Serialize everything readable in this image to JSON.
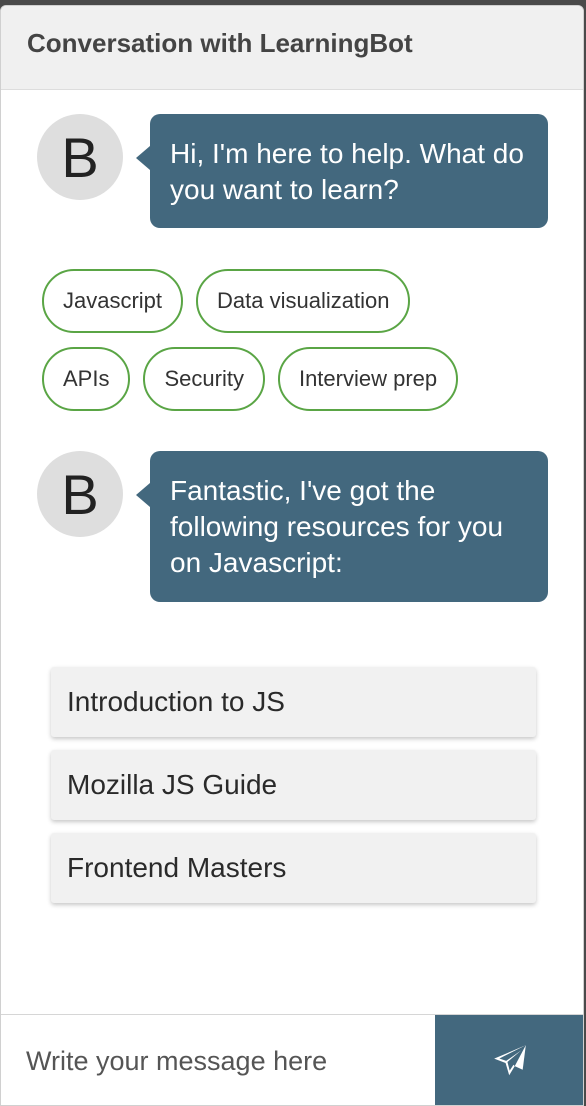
{
  "header": {
    "title": "Conversation with LearningBot"
  },
  "messages": [
    {
      "avatar_letter": "B",
      "text": "Hi, I'm here to help. What do you want to learn?"
    },
    {
      "avatar_letter": "B",
      "text": "Fantastic, I've got the following resources for you on Javascript:"
    }
  ],
  "topics": [
    "Javascript",
    "Data visualization",
    "APIs",
    "Security",
    "Interview prep"
  ],
  "resources": [
    "Introduction to JS",
    "Mozilla JS Guide",
    "Frontend Masters"
  ],
  "composer": {
    "placeholder": "Write your message here",
    "send_icon": "paper-plane-icon"
  },
  "colors": {
    "bubble": "#43687e",
    "chip_border": "#5aa545",
    "header_bg": "#f0f0f0"
  }
}
